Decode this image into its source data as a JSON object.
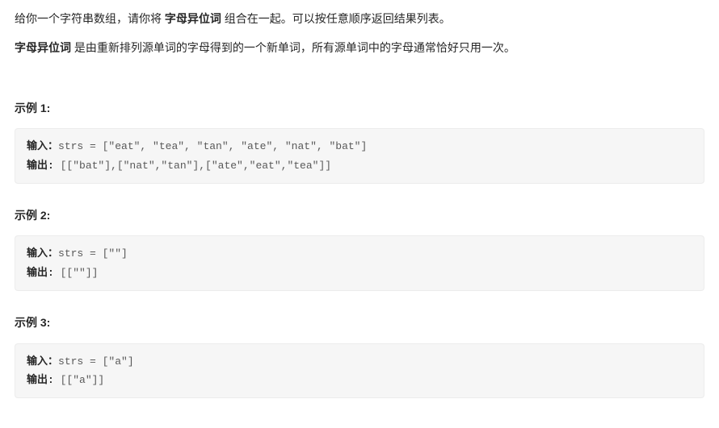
{
  "description": {
    "p1_prefix": "给你一个字符串数组，请你将 ",
    "p1_bold": "字母异位词",
    "p1_suffix": " 组合在一起。可以按任意顺序返回结果列表。",
    "p2_bold": "字母异位词",
    "p2_suffix": " 是由重新排列源单词的字母得到的一个新单词，所有源单词中的字母通常恰好只用一次。"
  },
  "examples": [
    {
      "heading": "示例 1:",
      "input_label": "输入：",
      "input_value": "strs = [\"eat\", \"tea\", \"tan\", \"ate\", \"nat\", \"bat\"]",
      "output_label": "输出: ",
      "output_value": "[[\"bat\"],[\"nat\",\"tan\"],[\"ate\",\"eat\",\"tea\"]]"
    },
    {
      "heading": "示例 2:",
      "input_label": "输入：",
      "input_value": "strs = [\"\"]",
      "output_label": "输出: ",
      "output_value": "[[\"\"]]"
    },
    {
      "heading": "示例 3:",
      "input_label": "输入：",
      "input_value": "strs = [\"a\"]",
      "output_label": "输出: ",
      "output_value": "[[\"a\"]]"
    }
  ]
}
